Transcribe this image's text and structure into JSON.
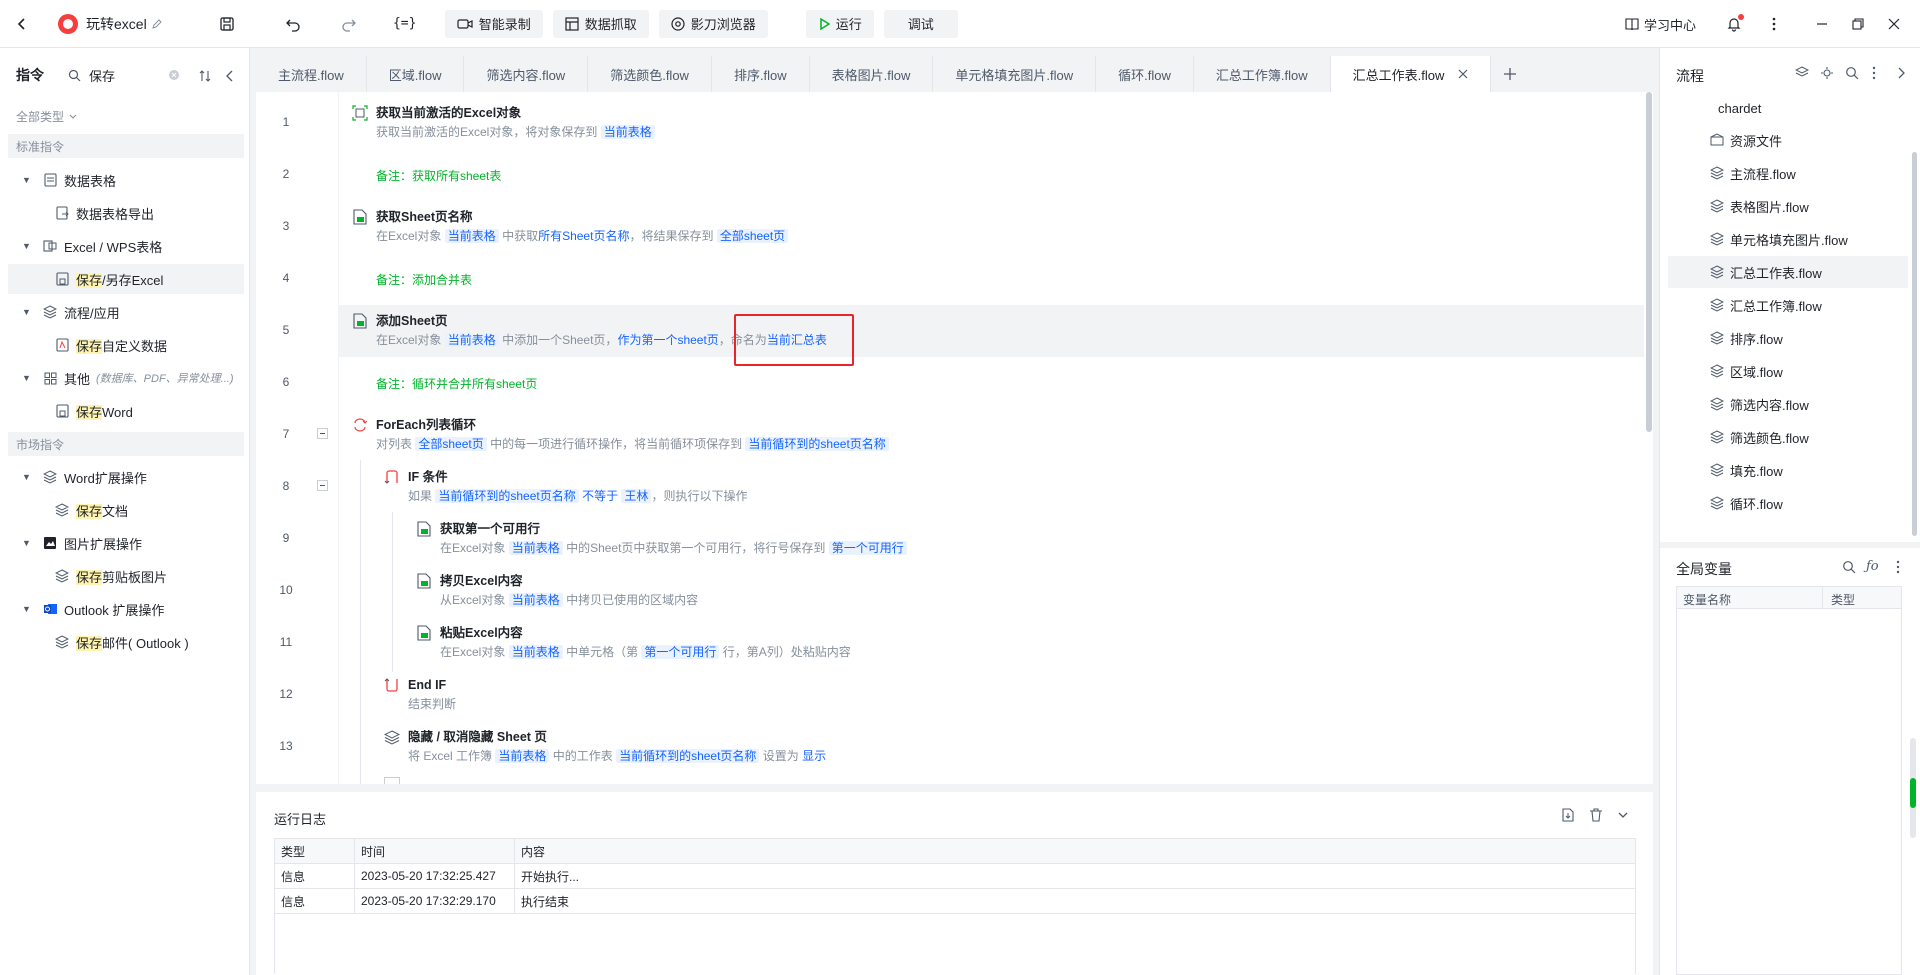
{
  "titlebar": {
    "app_title": "玩转excel",
    "buttons": {
      "smart_record": "智能录制",
      "data_capture": "数据抓取",
      "browser": "影刀浏览器",
      "run": "运行",
      "debug": "调试"
    },
    "learning_center": "学习中心"
  },
  "left": {
    "header": "指令",
    "search_value": "保存",
    "filter": "全部类型",
    "section_standard": "标准指令",
    "section_market": "市场指令",
    "items": [
      {
        "label": "数据表格"
      },
      {
        "label": "数据表格导出"
      },
      {
        "label": "Excel / WPS表格"
      },
      {
        "label_hl": "保存",
        "label_rest": "/另存Excel"
      },
      {
        "label": "流程/应用"
      },
      {
        "label_hl": "保存",
        "label_rest": "自定义数据"
      },
      {
        "label": "其他",
        "note": "(数据库、PDF、异常处理...)"
      },
      {
        "label_hl": "保存",
        "label_rest": "Word"
      },
      {
        "label": "Word扩展操作"
      },
      {
        "label_hl": "保存",
        "label_rest": "文档"
      },
      {
        "label": "图片扩展操作"
      },
      {
        "label_hl": "保存",
        "label_rest": "剪贴板图片"
      },
      {
        "label": "Outlook 扩展操作"
      },
      {
        "label_hl": "保存",
        "label_rest": "邮件( Outlook )"
      }
    ]
  },
  "tabs": [
    {
      "label": "主流程.flow"
    },
    {
      "label": "区域.flow"
    },
    {
      "label": "筛选内容.flow"
    },
    {
      "label": "筛选颜色.flow"
    },
    {
      "label": "排序.flow"
    },
    {
      "label": "表格图片.flow"
    },
    {
      "label": "单元格填充图片.flow"
    },
    {
      "label": "循环.flow"
    },
    {
      "label": "汇总工作簿.flow"
    },
    {
      "label": "汇总工作表.flow"
    }
  ],
  "lines": {
    "n1": "1",
    "n2": "2",
    "n3": "3",
    "n4": "4",
    "n5": "5",
    "n6": "6",
    "n7": "7",
    "n8": "8",
    "n9": "9",
    "n10": "10",
    "n11": "11",
    "n12": "12",
    "n13": "13",
    "l1_title": "获取当前激活的Excel对象",
    "l1_a": "获取当前激活的Excel对象，将对象保存到",
    "l1_v": "当前表格",
    "l2_note": "备注：获取所有sheet表",
    "l3_title": "获取Sheet页名称",
    "l3_a": "在Excel对象",
    "l3_v1": "当前表格",
    "l3_b": "中获取",
    "l3_c": "所有Sheet页名称",
    "l3_d": "，将结果保存到",
    "l3_v2": "全部sheet页",
    "l4_note": "备注：添加合并表",
    "l5_title": "添加Sheet页",
    "l5_a": "在Excel对象",
    "l5_v1": "当前表格",
    "l5_b": "中添加一个Sheet页，",
    "l5_c": "作为第一个sheet页",
    "l5_d": "，命名为",
    "l5_e": "当前汇总表",
    "l6_note": "备注：循环并合并所有sheet页",
    "l7_title": "ForEach列表循环",
    "l7_a": "对列表",
    "l7_v1": "全部sheet页",
    "l7_b": "中的每一项进行循环操作，将当前循环项保存到",
    "l7_v2": "当前循环到的sheet页名称",
    "l8_title": "IF 条件",
    "l8_a": "如果",
    "l8_v1": "当前循环到的sheet页名称",
    "l8_v2": "不等于",
    "l8_v3": "王林",
    "l8_b": "，则执行以下操作",
    "l9_title": "获取第一个可用行",
    "l9_a": "在Excel对象",
    "l9_v1": "当前表格",
    "l9_b": "中的Sheet页中获取第一个可用行，将行号保存到",
    "l9_v2": "第一个可用行",
    "l10_title": "拷贝Excel内容",
    "l10_a": "从Excel对象",
    "l10_v1": "当前表格",
    "l10_b": "中拷贝已使用的区域内容",
    "l11_title": "粘贴Excel内容",
    "l11_a": "在Excel对象",
    "l11_v1": "当前表格",
    "l11_b": "中单元格（第",
    "l11_v2": "第一个可用行",
    "l11_c": "行，第A列）处粘贴内容",
    "l12_title": "End IF",
    "l12_a": "结束判断",
    "l13_title": "隐藏 / 取消隐藏 Sheet 页",
    "l13_a": "将 Excel 工作簿",
    "l13_v1": "当前表格",
    "l13_b": "中的工作表",
    "l13_v2": "当前循环到的sheet页名称",
    "l13_c": "设置为",
    "l13_v3": "显示"
  },
  "log": {
    "title": "运行日志",
    "headers": {
      "type": "类型",
      "time": "时间",
      "content": "内容"
    },
    "rows": [
      {
        "type": "信息",
        "time": "2023-05-20 17:32:25.427",
        "content": "开始执行..."
      },
      {
        "type": "信息",
        "time": "2023-05-20 17:32:29.170",
        "content": "执行结束"
      }
    ]
  },
  "right": {
    "title": "流程",
    "items": [
      {
        "label": "chardet"
      },
      {
        "label": "资源文件"
      },
      {
        "label": "主流程.flow"
      },
      {
        "label": "表格图片.flow"
      },
      {
        "label": "单元格填充图片.flow"
      },
      {
        "label": "汇总工作表.flow"
      },
      {
        "label": "汇总工作簿.flow"
      },
      {
        "label": "排序.flow"
      },
      {
        "label": "区域.flow"
      },
      {
        "label": "筛选内容.flow"
      },
      {
        "label": "筛选颜色.flow"
      },
      {
        "label": "填充.flow"
      },
      {
        "label": "循环.flow"
      }
    ],
    "vars": {
      "title": "全局变量",
      "col_name": "变量名称",
      "col_type": "类型"
    }
  },
  "colors": {
    "accent": "#1664ff",
    "note": "#00b42a",
    "highlight_box": "#e8262a",
    "run_green": "#00b42a"
  }
}
